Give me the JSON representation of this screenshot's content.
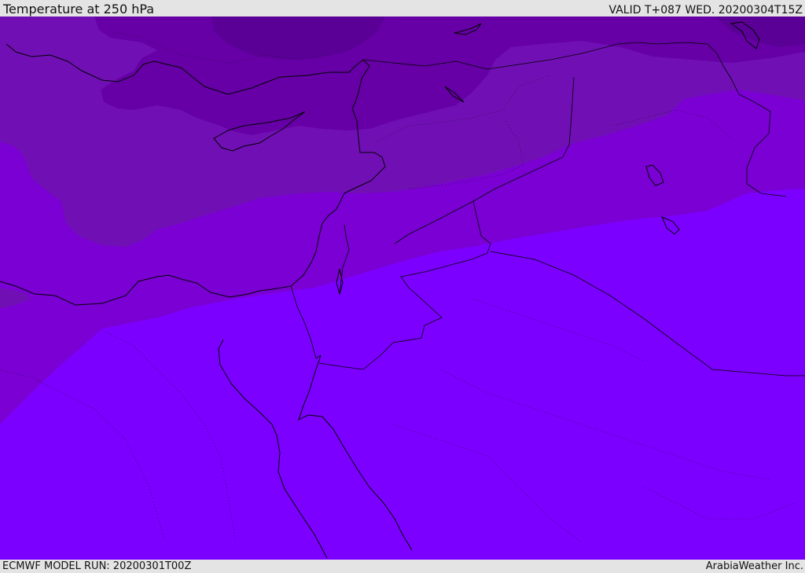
{
  "header": {
    "title": "Temperature at 250 hPa",
    "valid": "VALID T+087 WED. 20200304T15Z"
  },
  "footer": {
    "model_run": "ECMWF MODEL RUN: 20200301T00Z",
    "credit": "ArabiaWeather Inc."
  },
  "map": {
    "field": "temperature",
    "level": "250 hPa",
    "colors": {
      "band_darkest": "#5a0096",
      "band_dark": "#6600a6",
      "band_mid": "#7010b4",
      "band_light": "#7a00d4",
      "band_lightest": "#7c00ff",
      "coastline": "#000000"
    }
  }
}
